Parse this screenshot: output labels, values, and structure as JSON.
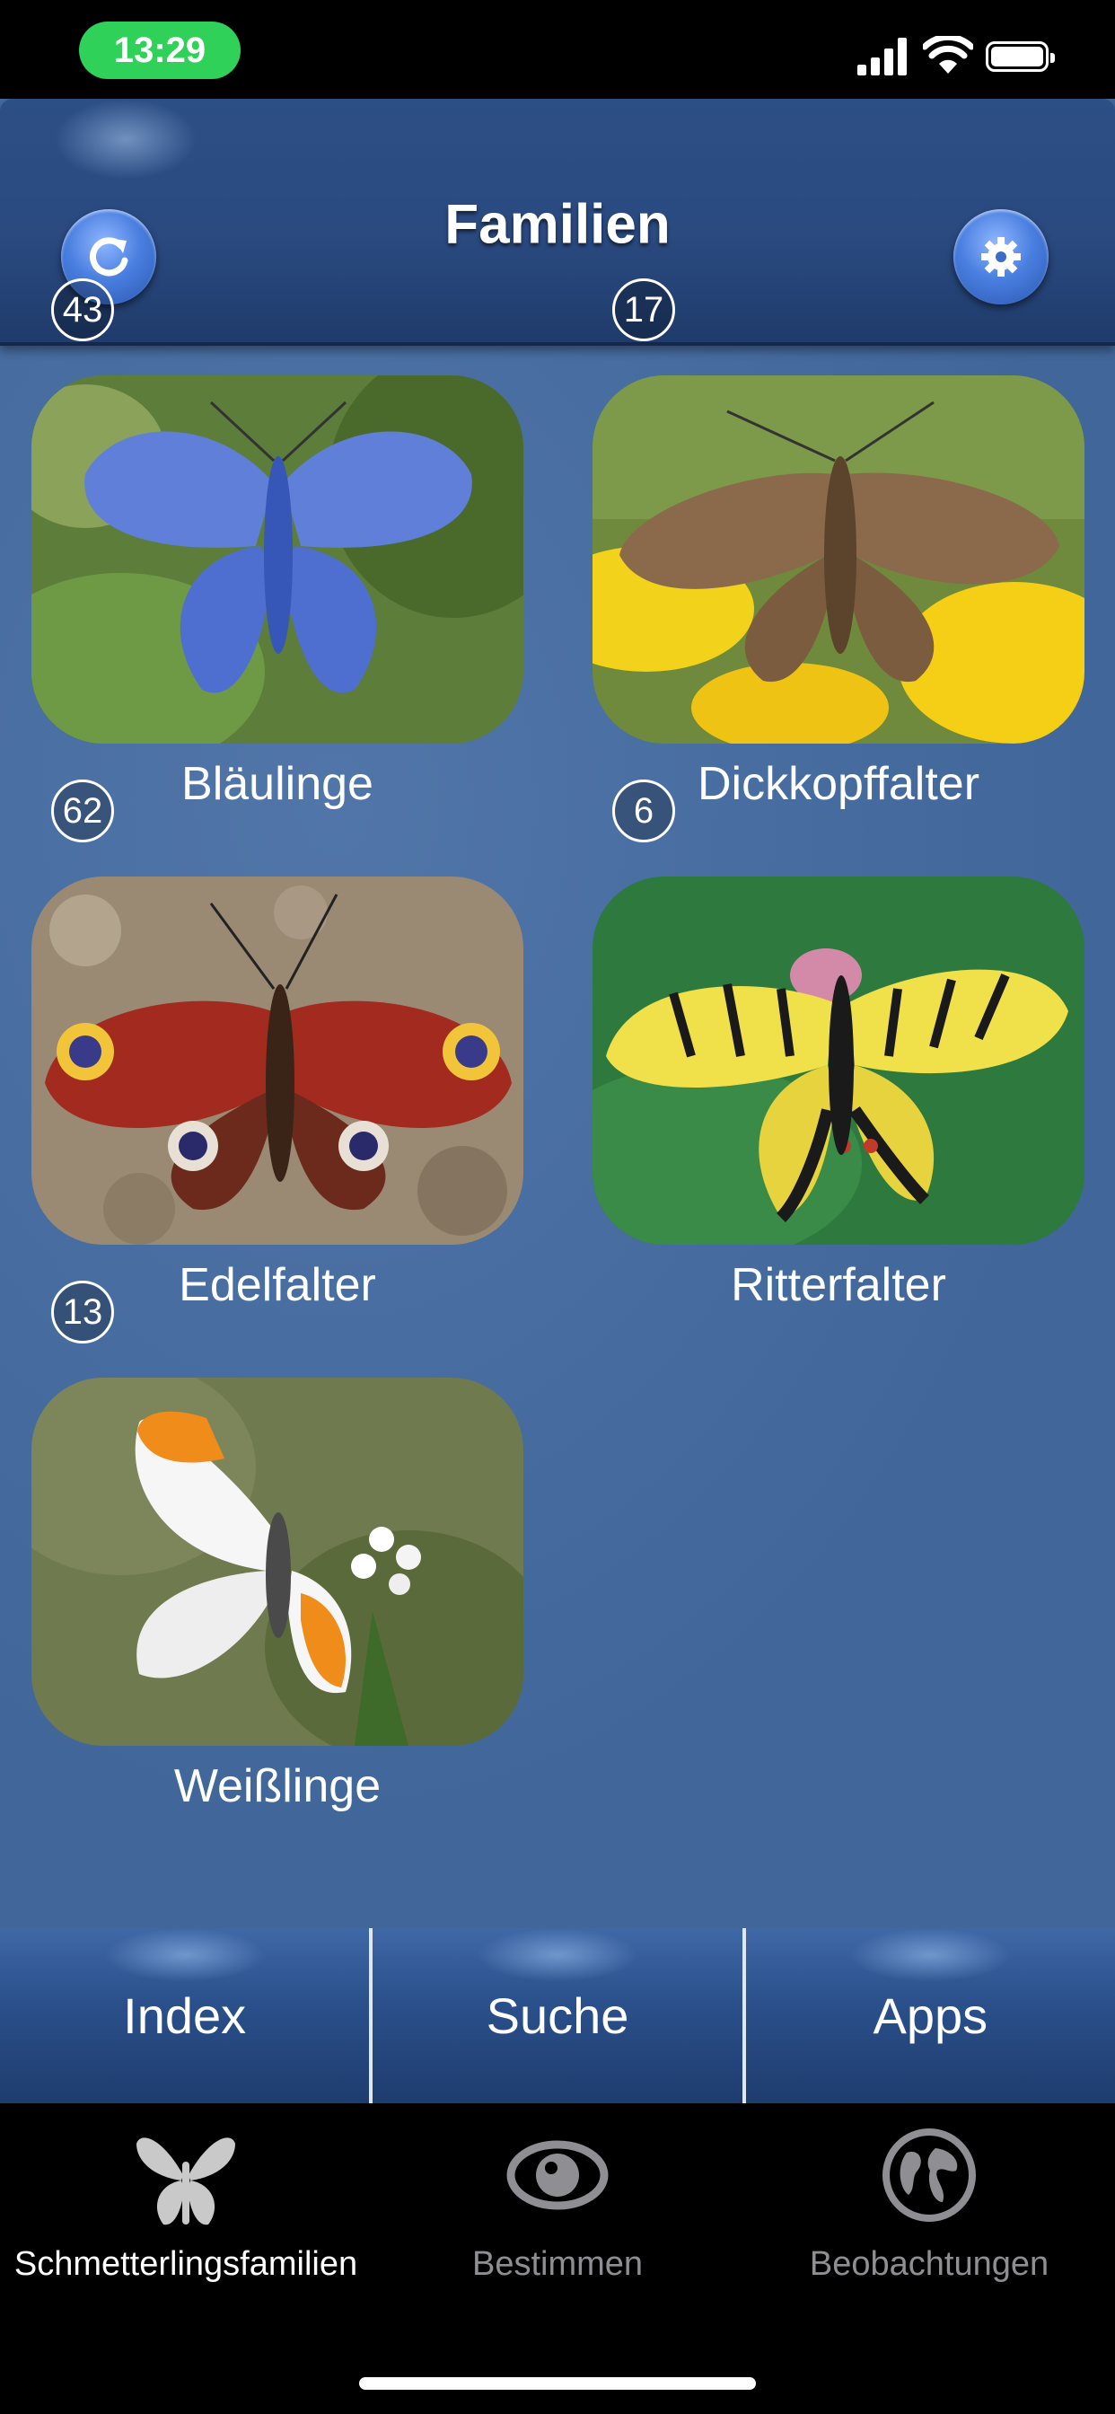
{
  "status_bar": {
    "time": "13:29"
  },
  "header": {
    "title": "Familien",
    "refresh_icon": "refresh-icon",
    "settings_icon": "gear-icon"
  },
  "families": [
    {
      "label": "Bläulinge",
      "count": "43",
      "image": "blue-butterfly"
    },
    {
      "label": "Dickkopffalter",
      "count": "17",
      "image": "brown-skipper"
    },
    {
      "label": "Edelfalter",
      "count": "62",
      "image": "peacock-butterfly"
    },
    {
      "label": "Ritterfalter",
      "count": "6",
      "image": "swallowtail"
    },
    {
      "label": "Weißlinge",
      "count": "13",
      "image": "orange-tip"
    }
  ],
  "bottom_buttons": [
    "Index",
    "Suche",
    "Apps"
  ],
  "tabs": [
    {
      "label": "Schmetterlingsfamilien",
      "icon": "butterfly-icon",
      "active": true
    },
    {
      "label": "Bestimmen",
      "icon": "eye-icon",
      "active": false
    },
    {
      "label": "Beobachtungen",
      "icon": "globe-icon",
      "active": false
    }
  ],
  "colors": {
    "background": "#40669a",
    "navbar": "#2a4a80",
    "status_pill": "#2fd158",
    "tab_active": "#ffffff",
    "tab_inactive": "#8e8e93"
  }
}
